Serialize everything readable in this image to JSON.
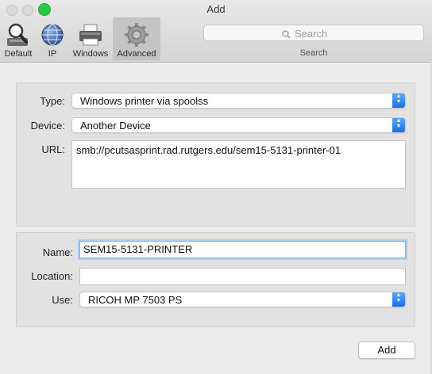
{
  "window": {
    "title": "Add"
  },
  "toolbar": {
    "items": [
      {
        "label": "Default",
        "icon": "magnifier-printer-icon",
        "selected": false
      },
      {
        "label": "IP",
        "icon": "globe-icon",
        "selected": false
      },
      {
        "label": "Windows",
        "icon": "printer-icon",
        "selected": false
      },
      {
        "label": "Advanced",
        "icon": "gear-icon",
        "selected": true
      }
    ],
    "search": {
      "placeholder": "Search",
      "caption": "Search"
    }
  },
  "connection": {
    "type_label": "Type:",
    "type_value": "Windows printer via spoolss",
    "device_label": "Device:",
    "device_value": "Another Device",
    "url_label": "URL:",
    "url_value": "smb://pcutsasprint.rad.rutgers.edu/sem15-5131-printer-01"
  },
  "details": {
    "name_label": "Name:",
    "name_value": "SEM15-5131-PRINTER",
    "location_label": "Location:",
    "location_value": "",
    "use_label": "Use:",
    "use_value": "RICOH MP 7503 PS"
  },
  "actions": {
    "add_label": "Add"
  },
  "colors": {
    "accent": "#1d6fe3",
    "selected_tab": "#c4c4c4",
    "focus_ring": "#a8cdf7"
  }
}
